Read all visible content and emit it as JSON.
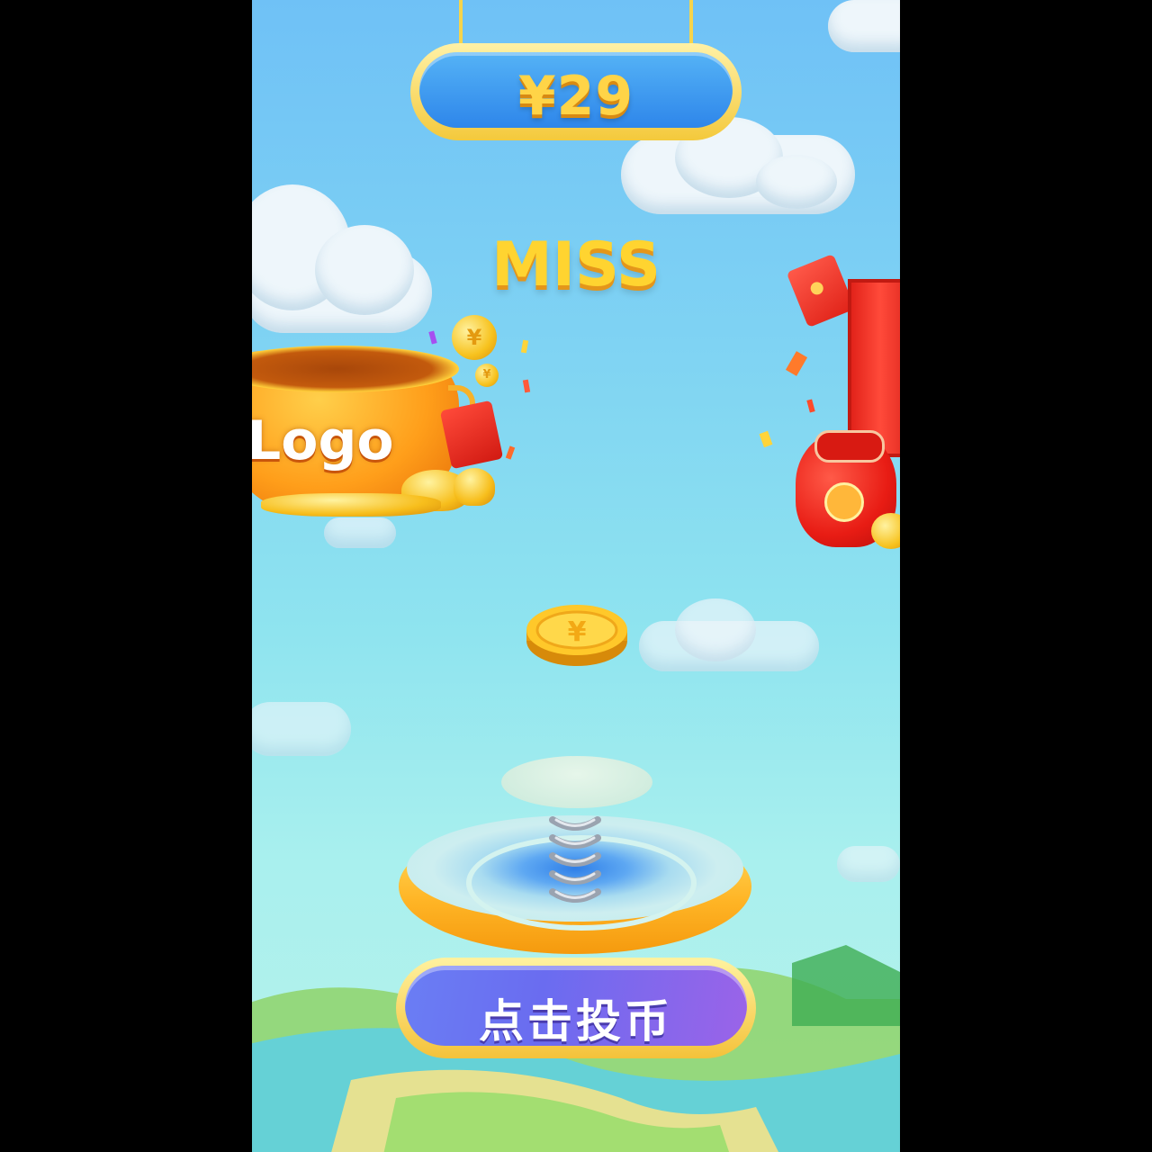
{
  "header": {
    "prize_amount": "¥29"
  },
  "status": {
    "result_text": "MISS"
  },
  "left_reward": {
    "logo_text": "Logo",
    "coin_symbol": "¥"
  },
  "flying_coin": {
    "symbol": "¥"
  },
  "action": {
    "insert_coin_label": "点击投币"
  },
  "colors": {
    "sky_top": "#6fc1f6",
    "sky_bottom": "#b7f2ea",
    "gold": "#ffd447",
    "button_purple": "#6a6cf0"
  },
  "icons": [
    "gold-pot-icon",
    "red-envelope-icon",
    "treasure-chest-icon",
    "lucky-bag-icon",
    "gold-coin-icon",
    "spring-launcher-icon"
  ]
}
